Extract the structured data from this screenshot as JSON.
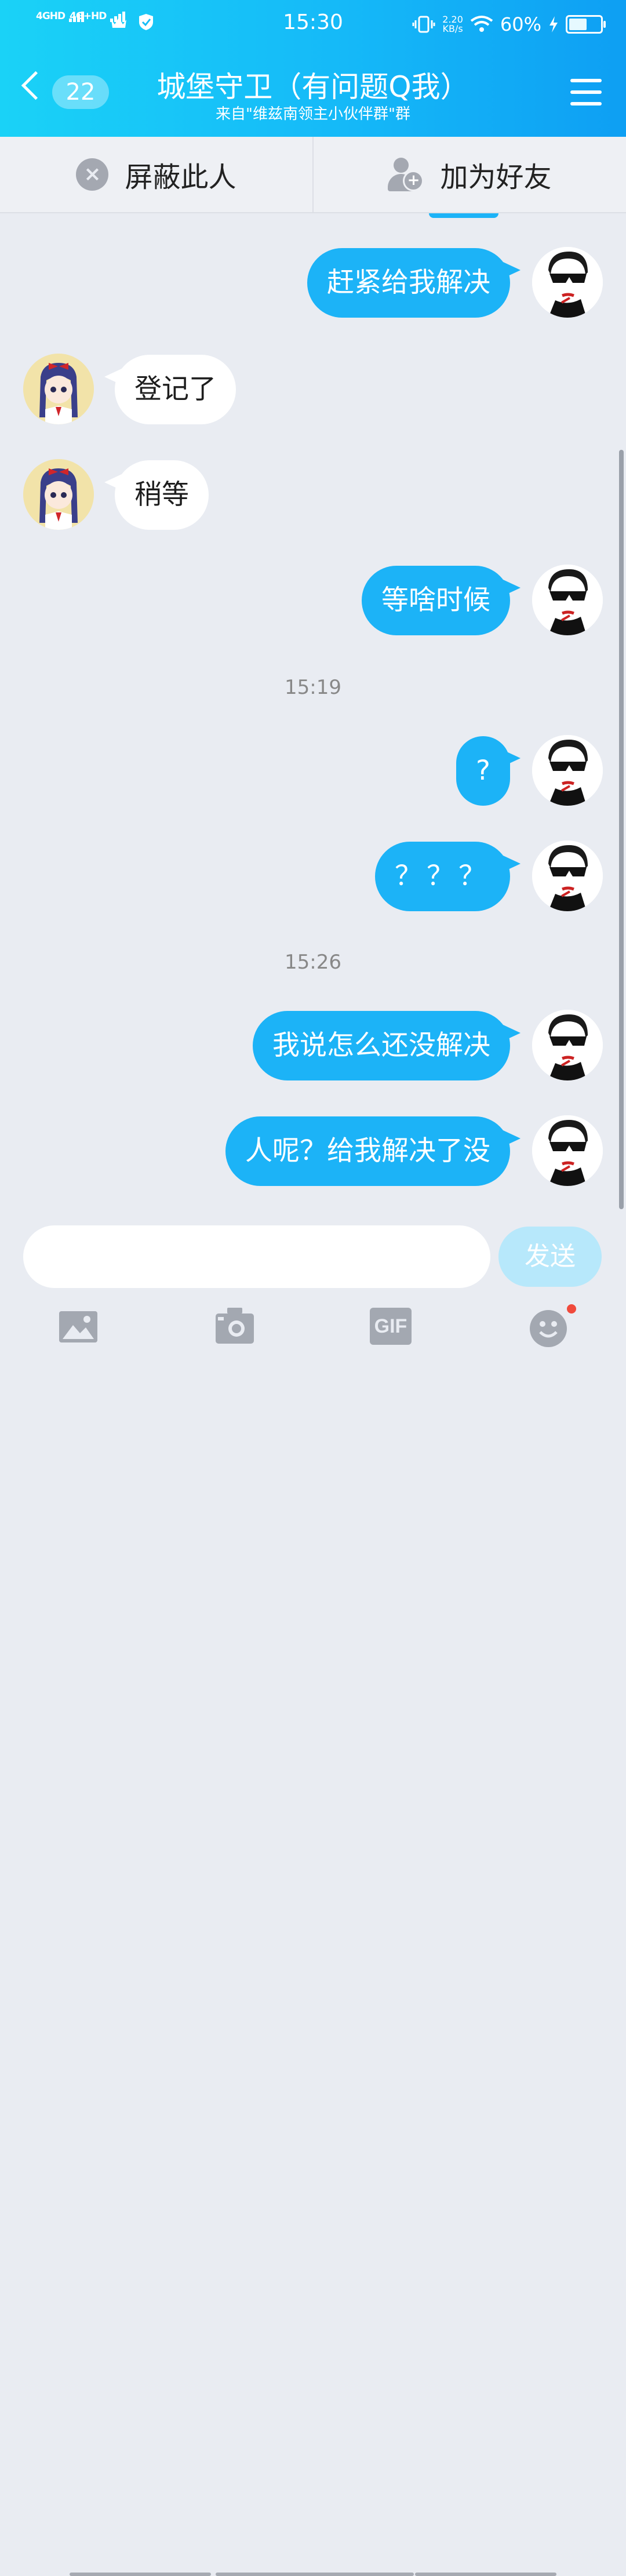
{
  "status_bar": {
    "sim1": "4GHD",
    "sim2": "4G+HD",
    "time": "15:30",
    "net_speed": "2.20\nKB/s",
    "battery": "60%"
  },
  "header": {
    "back_count": "22",
    "title": "城堡守卫（有问题Q我）",
    "subtitle": "来自\"维兹南领主小伙伴群\"群",
    "menu_icon": "menu-icon"
  },
  "actions": {
    "block_label": "屏蔽此人",
    "add_friend_label": "加为好友"
  },
  "messages": [
    {
      "side": "out",
      "text": "赶紧给我解决"
    },
    {
      "side": "in",
      "text": "登记了"
    },
    {
      "side": "in",
      "text": "稍等"
    },
    {
      "side": "out",
      "text": "等啥时候"
    },
    {
      "type": "time",
      "text": "15:19"
    },
    {
      "side": "out",
      "text": "?"
    },
    {
      "side": "out",
      "text": "？？？"
    },
    {
      "type": "time",
      "text": "15:26"
    },
    {
      "side": "out",
      "text": "我说怎么还没解决"
    },
    {
      "side": "out",
      "text": "人呢？给我解决了没"
    }
  ],
  "input": {
    "placeholder": "",
    "send_label": "发送"
  },
  "toolbar": {
    "gif_label": "GIF"
  },
  "colors": {
    "accent": "#1cb3f7",
    "header_start": "#1ad2f7",
    "header_end": "#0e9ff3",
    "notification_dot": "#f04a3c"
  }
}
